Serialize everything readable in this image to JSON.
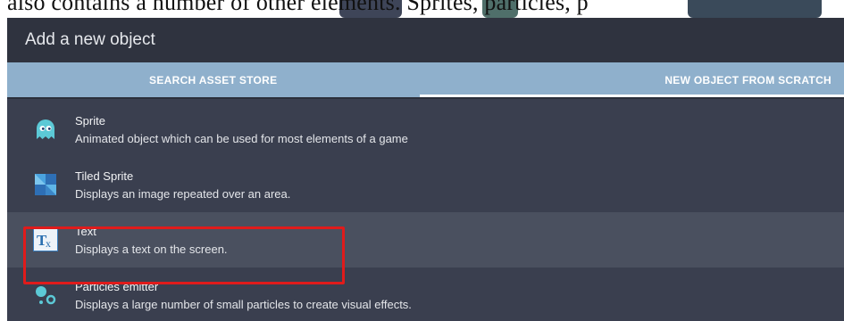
{
  "document": {
    "cropped_line": "also contains a number of other elements. Sprites, particles, p"
  },
  "dialog": {
    "title": "Add a new object",
    "tabs": [
      {
        "label": "SEARCH ASSET STORE",
        "selected": false
      },
      {
        "label": "NEW OBJECT FROM SCRATCH",
        "selected": true
      }
    ],
    "items": [
      {
        "name": "Sprite",
        "description": "Animated object which can be used for most elements of a game",
        "icon": "ghost-icon"
      },
      {
        "name": "Tiled Sprite",
        "description": "Displays an image repeated over an area.",
        "icon": "tiles-icon"
      },
      {
        "name": "Text",
        "description": "Displays a text on the screen.",
        "icon": "text-tx-icon",
        "highlighted": true
      },
      {
        "name": "Particles emitter",
        "description": "Displays a large number of small particles to create visual effects.",
        "icon": "particles-icon"
      }
    ]
  },
  "colors": {
    "dialog_bg": "#3a3f4f",
    "title_bg": "#2f333f",
    "tabs_bg": "#8fb0cc",
    "highlight_border": "#e01b1b"
  }
}
